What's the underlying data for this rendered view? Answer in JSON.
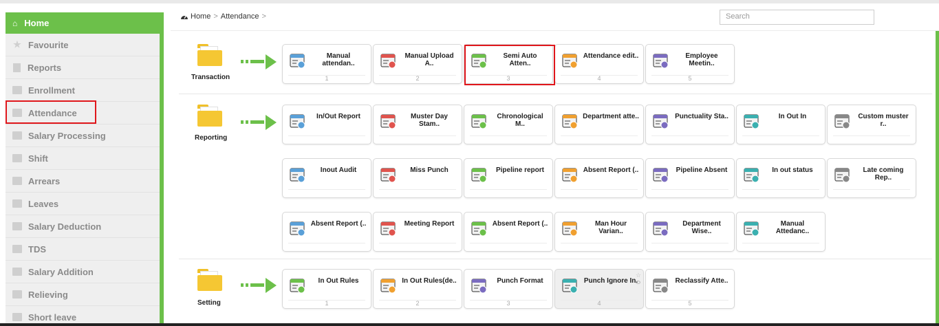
{
  "breadcrumb": {
    "home": "Home",
    "current": "Attendance",
    "sep": ">"
  },
  "search": {
    "placeholder": "Search"
  },
  "sidebar": {
    "items": [
      {
        "label": "Home",
        "icon": "home-icon"
      },
      {
        "label": "Favourite",
        "icon": "star-icon"
      },
      {
        "label": "Reports",
        "icon": "document-icon"
      },
      {
        "label": "Enrollment",
        "icon": "folder-icon"
      },
      {
        "label": "Attendance",
        "icon": "folder-icon"
      },
      {
        "label": "Salary Processing",
        "icon": "folder-icon"
      },
      {
        "label": "Shift",
        "icon": "folder-icon"
      },
      {
        "label": "Arrears",
        "icon": "folder-icon"
      },
      {
        "label": "Leaves",
        "icon": "folder-icon"
      },
      {
        "label": "Salary Deduction",
        "icon": "folder-icon"
      },
      {
        "label": "TDS",
        "icon": "folder-icon"
      },
      {
        "label": "Salary Addition",
        "icon": "folder-icon"
      },
      {
        "label": "Relieving",
        "icon": "folder-icon"
      },
      {
        "label": "Short leave",
        "icon": "folder-icon"
      }
    ]
  },
  "sections": {
    "transaction": {
      "label": "Transaction",
      "cards": [
        {
          "title": "Manual attendan..",
          "num": "1",
          "icon": "calendar-hand-icon"
        },
        {
          "title": "Manual Upload A..",
          "num": "2",
          "icon": "calendar-upload-icon"
        },
        {
          "title": "Semi Auto Atten..",
          "num": "3",
          "icon": "stopwatch-icon"
        },
        {
          "title": "Attendance edit..",
          "num": "4",
          "icon": "calendar-grid-icon"
        },
        {
          "title": "Employee Meetin..",
          "num": "5",
          "icon": "meeting-icon"
        }
      ]
    },
    "reporting": {
      "label": "Reporting",
      "cards": [
        {
          "title": "In/Out Report",
          "icon": "report-list-icon"
        },
        {
          "title": "Muster Day Stam..",
          "icon": "chart-pie-icon"
        },
        {
          "title": "Chronological M..",
          "icon": "hourglass-chart-icon"
        },
        {
          "title": "Department atte..",
          "icon": "server-list-icon"
        },
        {
          "title": "Punctuality Sta..",
          "icon": "clock-person-icon"
        },
        {
          "title": "In Out In",
          "icon": "door-icon"
        },
        {
          "title": "Custom muster r..",
          "icon": "clipboard-icon"
        },
        {
          "title": "Inout Audit",
          "icon": "clock-arrows-icon"
        },
        {
          "title": "Miss Punch",
          "icon": "hand-tap-icon"
        },
        {
          "title": "Pipeline report",
          "icon": "pipeline-icon"
        },
        {
          "title": "Absent Report (..",
          "icon": "calendar-person-icon"
        },
        {
          "title": "Pipeline Absent",
          "icon": "gear-person-icon"
        },
        {
          "title": "In out status",
          "icon": "status-network-icon"
        },
        {
          "title": "Late coming Rep..",
          "icon": "running-person-icon"
        },
        {
          "title": "Absent Report (..",
          "icon": "calendar-grid-icon"
        },
        {
          "title": "Meeting Report",
          "icon": "meeting-room-icon"
        },
        {
          "title": "Absent Report (..",
          "icon": "calendar-people-icon"
        },
        {
          "title": "Man Hour Varian..",
          "icon": "chart-gears-icon"
        },
        {
          "title": "Department Wise..",
          "icon": "chart-gears-icon"
        },
        {
          "title": "Manual Attedanc..",
          "icon": "chart-gears-icon"
        }
      ]
    },
    "setting": {
      "label": "Setting",
      "cards": [
        {
          "title": "In Out Rules",
          "num": "1",
          "icon": "clock-arrows-icon"
        },
        {
          "title": "In Out Rules(de..",
          "num": "2",
          "icon": "building-icon"
        },
        {
          "title": "Punch Format",
          "num": "3",
          "icon": "csv-file-icon"
        },
        {
          "title": "Punch Ignore In.",
          "num": "4",
          "icon": "clock-person-icon"
        },
        {
          "title": "Reclassify Atte..",
          "num": "5",
          "icon": "person-podium-icon"
        }
      ]
    }
  },
  "colors": {
    "accent": "#6cc04a",
    "highlight": "#e0161b",
    "folder": "#f5c733"
  }
}
